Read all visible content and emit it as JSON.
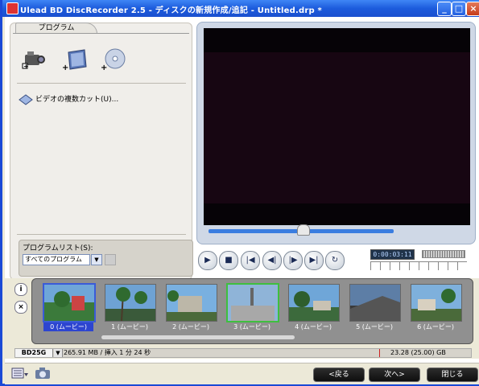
{
  "window": {
    "title": "Ulead BD DiscRecorder 2.5 - ディスクの新規作成/追記 - Untitled.drp *"
  },
  "left_panel": {
    "tab_label": "プログラム",
    "cut_label": "ビデオの複数カット(U)...",
    "program_list_label": "プログラムリスト(S):",
    "program_list_value": "すべてのプログラム"
  },
  "player": {
    "timecode": "0:00:03:11"
  },
  "clips": [
    {
      "label": "0 (ムービー)",
      "selected": true
    },
    {
      "label": "1 (ムービー)"
    },
    {
      "label": "2 (ムービー)"
    },
    {
      "label": "3 (ムービー)"
    },
    {
      "label": "4 (ムービー)"
    },
    {
      "label": "5 (ムービー)"
    },
    {
      "label": "6 (ムービー)"
    }
  ],
  "status": {
    "disc_type": "BD25G",
    "used": "265.91 MB / 挿入  1 分 24 秒",
    "capacity": "23.28 (25.00) GB"
  },
  "footer": {
    "back": "<戻る",
    "next": "次へ>",
    "close": "閉じる"
  },
  "colors": {
    "titlebar": "#1c5bdc",
    "selection": "#2d45d0",
    "highlight": "#3fbf3f"
  }
}
